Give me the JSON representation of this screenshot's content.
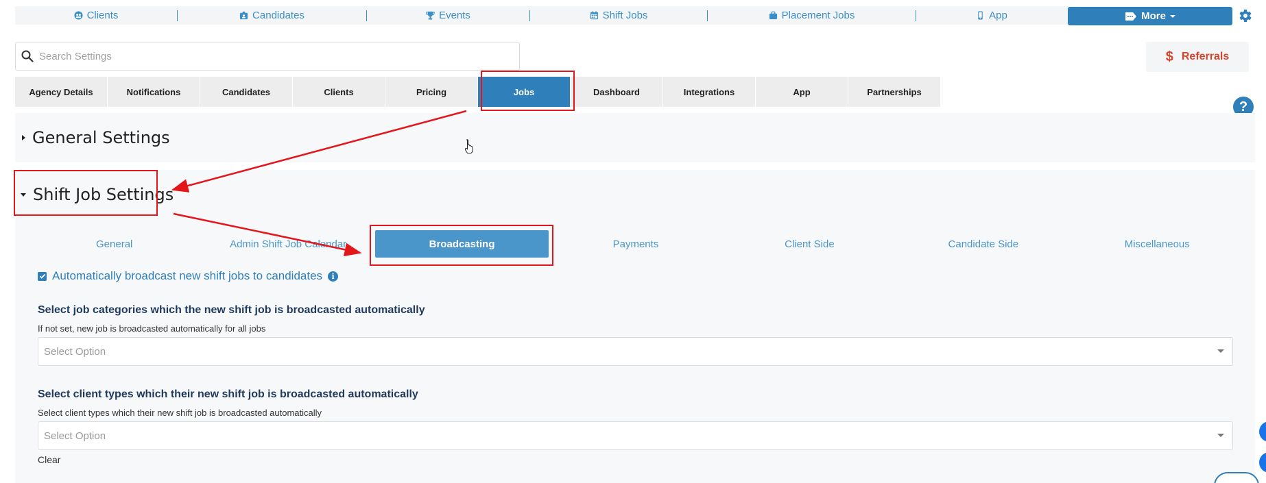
{
  "topnav": {
    "items": [
      {
        "label": "Clients",
        "icon": "clients-icon"
      },
      {
        "label": "Candidates",
        "icon": "candidates-icon"
      },
      {
        "label": "Events",
        "icon": "trophy-icon"
      },
      {
        "label": "Shift Jobs",
        "icon": "calendar-icon"
      },
      {
        "label": "Placement Jobs",
        "icon": "briefcase-icon"
      },
      {
        "label": "App",
        "icon": "mobile-icon"
      }
    ],
    "more_label": "More",
    "accent": "#2e7fba"
  },
  "search": {
    "placeholder": "Search Settings"
  },
  "referrals": {
    "label": "Referrals",
    "symbol": "$",
    "color": "#d6452c"
  },
  "tabs": {
    "items": [
      "Agency Details",
      "Notifications",
      "Candidates",
      "Clients",
      "Pricing",
      "Jobs",
      "Dashboard",
      "Integrations",
      "App",
      "Partnerships"
    ],
    "active": "Jobs"
  },
  "help_symbol": "?",
  "sections": {
    "general": {
      "title": "General Settings"
    },
    "shift": {
      "title": "Shift Job Settings"
    }
  },
  "subtabs": {
    "items": [
      "General",
      "Admin Shift Job Calendar",
      "Broadcasting",
      "Payments",
      "Client Side",
      "Candidate Side",
      "Miscellaneous"
    ],
    "active": "Broadcasting"
  },
  "broadcast": {
    "auto_label": "Automatically broadcast new shift jobs to candidates",
    "auto_checked": true,
    "categories": {
      "label": "Select job categories which the new shift job is broadcasted automatically",
      "hint": "If not set, new job is broadcasted automatically for all jobs",
      "placeholder": "Select Option"
    },
    "client_types": {
      "label": "Select client types which their new shift job is broadcasted automatically",
      "hint": "Select client types which their new shift job is broadcasted automatically",
      "placeholder": "Select Option"
    },
    "clear_label": "Clear"
  }
}
